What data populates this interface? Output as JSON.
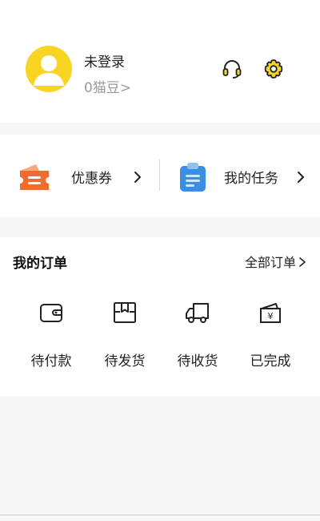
{
  "profile": {
    "username": "未登录",
    "beans": "0猫豆>",
    "avatar_icon": "user-silhouette-icon",
    "support_icon": "headset-icon",
    "settings_icon": "gear-icon",
    "accent_color": "#f9d523"
  },
  "quick_links": [
    {
      "label": "优惠券",
      "icon": "coupon-icon",
      "color": "#f06b32"
    },
    {
      "label": "我的任务",
      "icon": "clipboard-task-icon",
      "color": "#3a8ee6"
    }
  ],
  "orders": {
    "title": "我的订单",
    "all_label": "全部订单",
    "items": [
      {
        "label": "待付款",
        "icon": "wallet-icon"
      },
      {
        "label": "待发货",
        "icon": "package-box-icon"
      },
      {
        "label": "待收货",
        "icon": "delivery-truck-icon"
      },
      {
        "label": "已完成",
        "icon": "yen-receipt-icon"
      }
    ]
  }
}
